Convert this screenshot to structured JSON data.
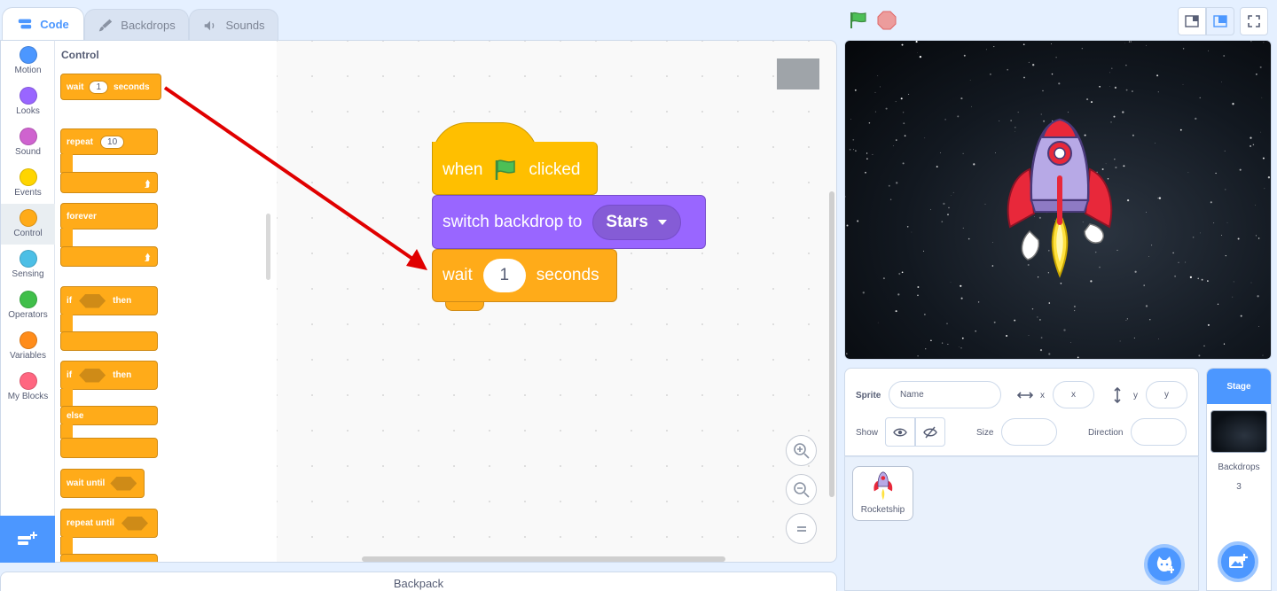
{
  "tabs": {
    "code": "Code",
    "backdrops": "Backdrops",
    "sounds": "Sounds"
  },
  "categories": [
    {
      "label": "Motion",
      "color": "#4c97ff"
    },
    {
      "label": "Looks",
      "color": "#9966ff"
    },
    {
      "label": "Sound",
      "color": "#cf63cf"
    },
    {
      "label": "Events",
      "color": "#ffd500"
    },
    {
      "label": "Control",
      "color": "#ffab19"
    },
    {
      "label": "Sensing",
      "color": "#4cbfe6"
    },
    {
      "label": "Operators",
      "color": "#40bf4a"
    },
    {
      "label": "Variables",
      "color": "#ff8c1a"
    },
    {
      "label": "My Blocks",
      "color": "#ff6680"
    }
  ],
  "palette": {
    "title": "Control",
    "wait": {
      "prefix": "wait",
      "value": "1",
      "suffix": "seconds"
    },
    "repeat": {
      "label": "repeat",
      "value": "10"
    },
    "forever": "forever",
    "if_then": {
      "if": "if",
      "then": "then"
    },
    "if_else": {
      "if": "if",
      "then": "then",
      "else": "else"
    },
    "wait_until": "wait until",
    "repeat_until": "repeat until"
  },
  "script": {
    "hat": {
      "when": "when",
      "clicked": "clicked"
    },
    "backdrop": {
      "label": "switch backdrop to",
      "value": "Stars"
    },
    "wait": {
      "prefix": "wait",
      "value": "1",
      "suffix": "seconds"
    }
  },
  "backpack": "Backpack",
  "sprite_info": {
    "sprite_label": "Sprite",
    "name_placeholder": "Name",
    "x_label": "x",
    "x_placeholder": "x",
    "y_label": "y",
    "y_placeholder": "y",
    "show_label": "Show",
    "size_label": "Size",
    "direction_label": "Direction"
  },
  "sprites": [
    {
      "name": "Rocketship"
    }
  ],
  "stage_panel": {
    "title": "Stage",
    "backdrops_label": "Backdrops",
    "backdrops_count": "3"
  },
  "colors": {
    "accent": "#4c97ff",
    "control": "#ffab19",
    "looks": "#9966ff",
    "events": "#ffbf00",
    "arrow": "#e00000"
  }
}
